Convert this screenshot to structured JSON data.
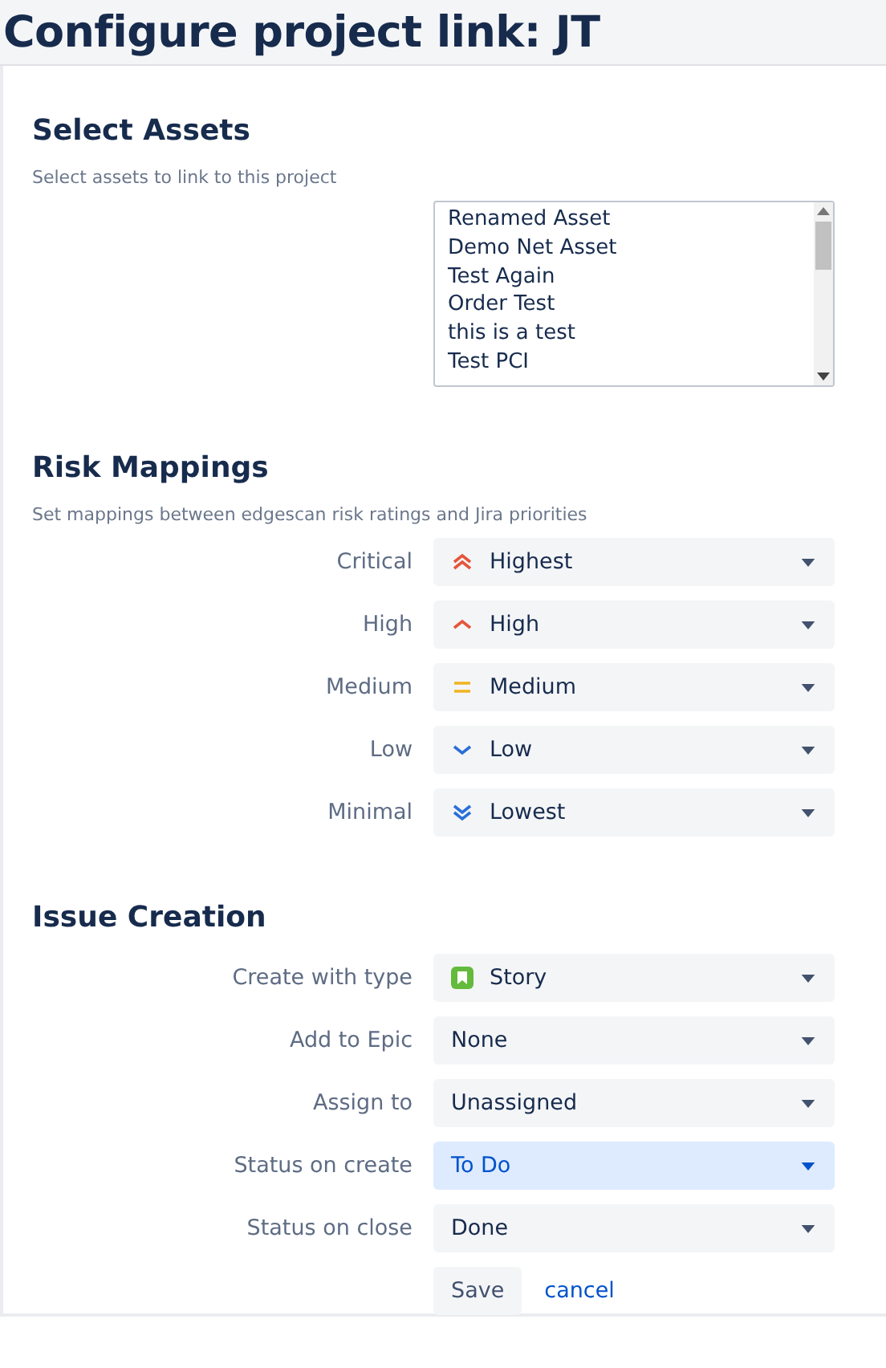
{
  "title": "Configure project link: JT",
  "select_assets": {
    "heading": "Select Assets",
    "description": "Select assets to link to this project",
    "assets": [
      "Renamed Asset",
      "Demo Net Asset",
      "Test Again",
      "Order Test",
      "this is a test",
      "Test PCI"
    ]
  },
  "risk_mappings": {
    "heading": "Risk Mappings",
    "description": "Set mappings between edgescan risk ratings and Jira priorities",
    "rows": [
      {
        "label": "Critical",
        "value": "Highest",
        "kind": "highest"
      },
      {
        "label": "High",
        "value": "High",
        "kind": "high"
      },
      {
        "label": "Medium",
        "value": "Medium",
        "kind": "medium"
      },
      {
        "label": "Low",
        "value": "Low",
        "kind": "low"
      },
      {
        "label": "Minimal",
        "value": "Lowest",
        "kind": "lowest"
      }
    ]
  },
  "issue_creation": {
    "heading": "Issue Creation",
    "rows": [
      {
        "label": "Create with type",
        "value": "Story",
        "kind": "story",
        "focused": false
      },
      {
        "label": "Add to Epic",
        "value": "None",
        "focused": false
      },
      {
        "label": "Assign to",
        "value": "Unassigned",
        "focused": false
      },
      {
        "label": "Status on create",
        "value": "To Do",
        "focused": true
      },
      {
        "label": "Status on close",
        "value": "Done",
        "focused": false
      }
    ]
  },
  "buttons": {
    "save": "Save",
    "cancel": "cancel"
  }
}
